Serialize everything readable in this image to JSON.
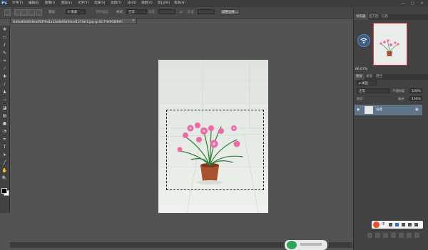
{
  "app": {
    "logo": "Ps",
    "menu": [
      "文件(F)",
      "编辑(E)",
      "图像(I)",
      "图层(L)",
      "文字(Y)",
      "选择(S)",
      "滤镜(T)",
      "3D(D)",
      "视图(V)",
      "窗口(W)",
      "帮助(H)"
    ],
    "window_controls": [
      "—",
      "□",
      "✕"
    ]
  },
  "options": {
    "feather_label": "羽化:",
    "feather_value": "0 像素",
    "antialias_label": "消除锯齿",
    "style_label": "样式:",
    "style_value": "正常",
    "width_label": "宽度:",
    "height_label": "高度:",
    "refine_edge": "调整边缘..."
  },
  "document": {
    "tab_title": "fcd0e80d4f49ea95379d1a53e0b95494cef1370af3.jpg @ 66.7%(RGB/8#)",
    "close": "×"
  },
  "tools": [
    {
      "icon": "move-icon",
      "glyph": "✥"
    },
    {
      "icon": "marquee-icon",
      "glyph": "▭"
    },
    {
      "icon": "lasso-icon",
      "glyph": "ℓ"
    },
    {
      "icon": "quick-select-icon",
      "glyph": "✎"
    },
    {
      "icon": "crop-icon",
      "glyph": "⌗"
    },
    {
      "icon": "eyedropper-icon",
      "glyph": "⁄"
    },
    {
      "icon": "healing-icon",
      "glyph": "✚"
    },
    {
      "icon": "brush-icon",
      "glyph": "∕"
    },
    {
      "icon": "stamp-icon",
      "glyph": "♟"
    },
    {
      "icon": "history-brush-icon",
      "glyph": "∽"
    },
    {
      "icon": "eraser-icon",
      "glyph": "◪"
    },
    {
      "icon": "gradient-icon",
      "glyph": "▤"
    },
    {
      "icon": "blur-icon",
      "glyph": "●"
    },
    {
      "icon": "dodge-icon",
      "glyph": "◔"
    },
    {
      "icon": "pen-icon",
      "glyph": "✒"
    },
    {
      "icon": "type-icon",
      "glyph": "T"
    },
    {
      "icon": "path-select-icon",
      "glyph": "➤"
    },
    {
      "icon": "shape-icon",
      "glyph": "╱"
    },
    {
      "icon": "hand-icon",
      "glyph": "✋"
    },
    {
      "icon": "zoom-icon",
      "glyph": "🔍"
    }
  ],
  "panels": {
    "navigator_tabs": [
      "导航器",
      "直方图",
      "信息"
    ],
    "zoom_value": "66.67%",
    "layers_tabs": [
      "图层",
      "通道",
      "路径"
    ],
    "kind_label": "ρ 类型",
    "blend_mode": "正常",
    "opacity_label": "不透明度:",
    "opacity_value": "100%",
    "lock_label": "锁定:",
    "fill_label": "填充:",
    "fill_value": "100%",
    "layer_name": "背景"
  },
  "taskbar": {
    "ime_label": "中"
  },
  "colors": {
    "accent": "#5f7389",
    "workspace": "#535353",
    "panel": "#424242",
    "nav_frame": "#d64040"
  }
}
